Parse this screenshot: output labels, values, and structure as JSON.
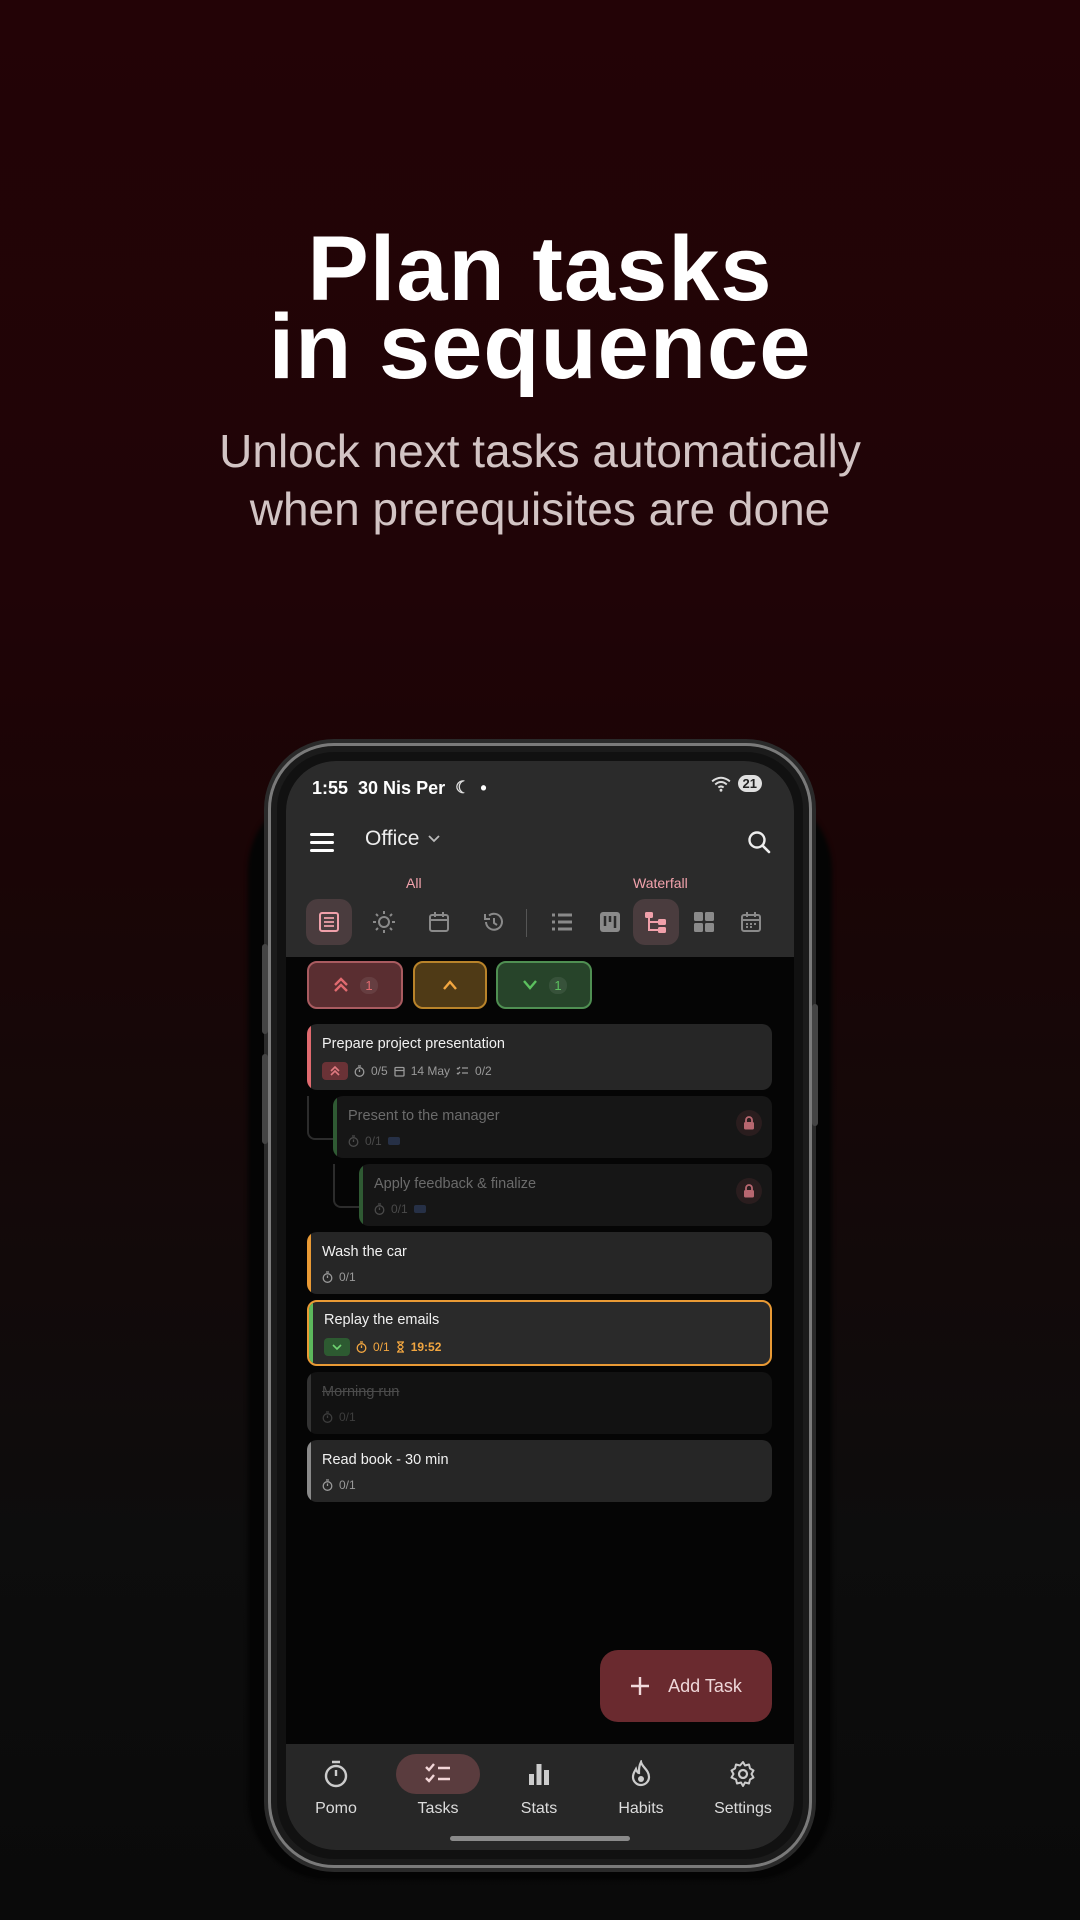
{
  "headline": {
    "line1": "Plan tasks",
    "line2": "in sequence"
  },
  "subline": {
    "line1": "Unlock next tasks automatically",
    "line2": "when prerequisites are done"
  },
  "status": {
    "time": "1:55",
    "date": "30 Nis Per",
    "dot": "•",
    "battery": "21"
  },
  "appbar": {
    "project": "Office"
  },
  "filters": {
    "left_label": "All",
    "right_label": "Waterfall"
  },
  "priority_chips": {
    "high_count": "1",
    "low_count": "1"
  },
  "tasks": [
    {
      "title": "Prepare project presentation",
      "pomo": "0/5",
      "due": "14 May",
      "subtasks": "0/2"
    },
    {
      "title": "Present to the manager",
      "pomo": "0/1"
    },
    {
      "title": "Apply feedback & finalize",
      "pomo": "0/1"
    },
    {
      "title": "Wash the car",
      "pomo": "0/1"
    },
    {
      "title": "Replay the emails",
      "pomo": "0/1",
      "timer": "19:52"
    },
    {
      "title": "Morning run",
      "pomo": "0/1"
    },
    {
      "title": "Read book - 30 min",
      "pomo": "0/1"
    }
  ],
  "fab": {
    "label": "Add Task"
  },
  "nav": [
    {
      "label": "Pomo"
    },
    {
      "label": "Tasks"
    },
    {
      "label": "Stats"
    },
    {
      "label": "Habits"
    },
    {
      "label": "Settings"
    }
  ],
  "colors": {
    "accent": "#f3a3ad",
    "high": "#e06a6f",
    "medium": "#e99a35",
    "low": "#5cb85c",
    "fab": "#6a2a2f"
  }
}
